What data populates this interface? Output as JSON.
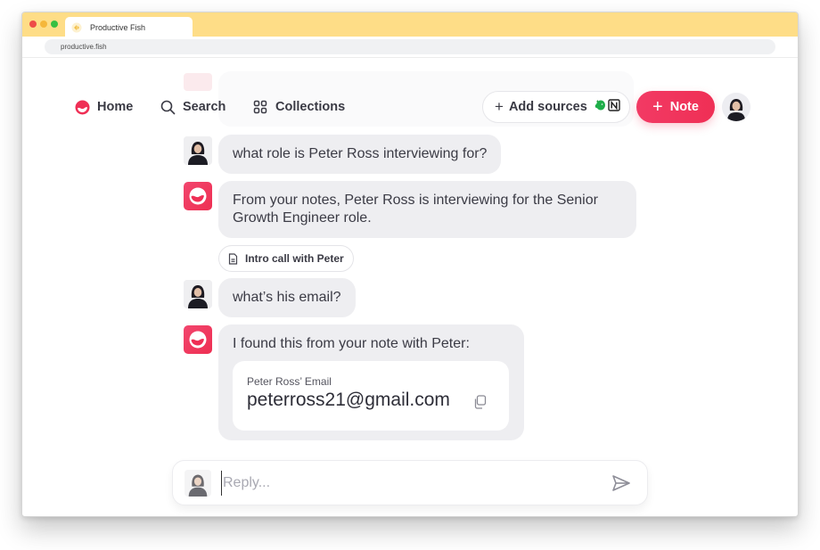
{
  "browser": {
    "tab_title": "Productive Fish",
    "tab_icon": "fish-logo-icon",
    "url": "productive.fish"
  },
  "nav": {
    "home": {
      "label": "Home",
      "icon": "home-logo-icon"
    },
    "search": {
      "label": "Search",
      "icon": "search-icon"
    },
    "collections": {
      "label": "Collections",
      "icon": "grid-icon"
    },
    "add_sources": {
      "label": "Add sources",
      "icons": [
        "evernote-icon",
        "notion-icon"
      ]
    },
    "note_button": {
      "label": "Note"
    },
    "profile_avatar": "user-avatar"
  },
  "conversation": {
    "messages": [
      {
        "role": "user",
        "text": "what role is Peter Ross interviewing for?"
      },
      {
        "role": "assistant",
        "text": "From your notes, Peter Ross is interviewing for the Senior Growth Engineer role.",
        "sources": [
          "Intro call with Peter"
        ]
      },
      {
        "role": "user",
        "text": "what’s his email?"
      },
      {
        "role": "assistant",
        "text": "I found this from your note with Peter:",
        "card": {
          "label": "Peter Ross’ Email",
          "value": "peterross21@gmail.com"
        }
      }
    ]
  },
  "reply": {
    "placeholder": "Reply...",
    "value": ""
  },
  "colors": {
    "accent": "#ef2f55",
    "titlebar": "#fedd87",
    "bubble": "#eeeef1"
  }
}
